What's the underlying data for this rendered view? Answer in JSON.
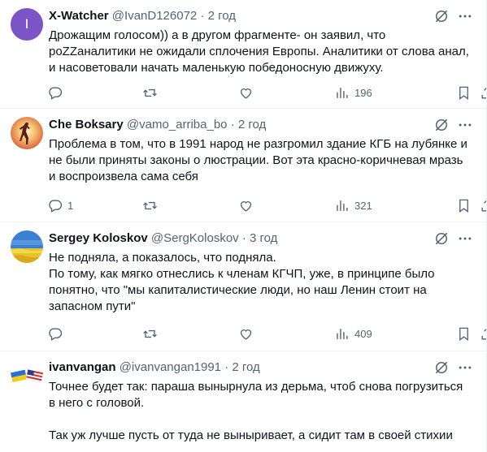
{
  "tweets": [
    {
      "avatar_letter": "I",
      "name": "X-Watcher",
      "handle": "@IvanD126072",
      "dot": "·",
      "time": "2 год",
      "lines": [
        "Дрожащим голосом)) а в другом фрагменте- он заявил, что",
        "poZZаналитики не ожидали сплочения Европы. Аналитики от слова анал,",
        "и насоветовали начать маленькую победоносную движуху."
      ],
      "replies": "",
      "reposts": "",
      "likes": "",
      "views": "196"
    },
    {
      "avatar_style": "sunset-silhouette",
      "name": "Che Boksary",
      "handle": "@vamo_arriba_bo",
      "dot": "·",
      "time": "2 год",
      "lines": [
        "Проблема в том, что в 1991 народ не разгромил здание КГБ на лубянке и",
        "не были приняты законы о люстрации. Вот эта красно-коричневая мразь",
        "и воспроизвела сама себя"
      ],
      "replies": "1",
      "reposts": "",
      "likes": "",
      "views": "321"
    },
    {
      "avatar_style": "ukraine-wheat-field",
      "name": "Sergey Koloskov",
      "handle": "@SergKoloskov",
      "dot": "·",
      "time": "3 год",
      "lines": [
        "Не подняла, а показалось, что подняла.",
        "По тому, как мягко отнеслись к членам КГЧП, уже, в принципе было",
        "понятно, что \"мы капиталистические люди, но наш Ленин стоит на",
        "запасном пути\""
      ],
      "replies": "",
      "reposts": "",
      "likes": "",
      "views": "409"
    },
    {
      "avatar_style": "ukraine-us-flags",
      "name": "ivanvangan",
      "handle": "@ivanvangan1991",
      "dot": "·",
      "time": "2 год",
      "lines": [
        "Точнее будет так: параша вынырнула из дерьма, чтоб снова погрузиться",
        "в него с головой.",
        "",
        "Так уж лучше пусть от туда не выныривает, а сидит там в своей стихии"
      ]
    }
  ],
  "colors": {
    "text": "#0f1419",
    "secondary": "#536471",
    "divider": "#eff3f4",
    "avatar_purple": "#7b54c6"
  },
  "icons": {
    "reply": "speech-bubble-icon",
    "repost": "repost-arrows-icon",
    "like": "heart-icon",
    "views": "bar-chart-icon",
    "bookmark": "bookmark-icon",
    "share": "share-upload-icon",
    "grok": "grok-slash-circle-icon",
    "more": "three-dots-icon"
  }
}
